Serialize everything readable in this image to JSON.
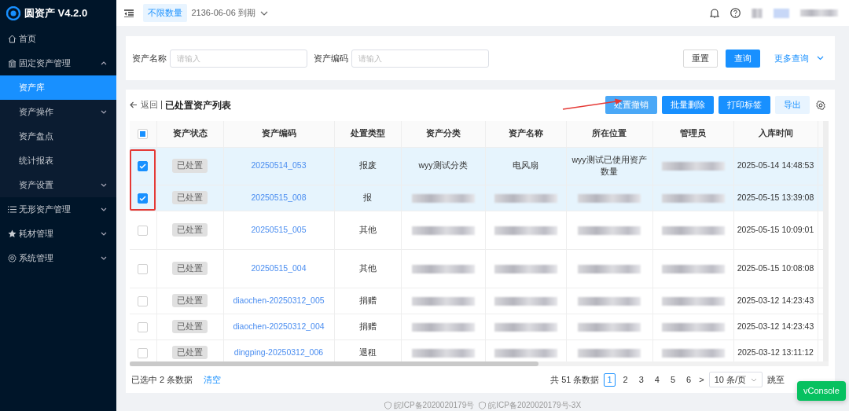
{
  "app": {
    "name": "圆资产 V4.2.0"
  },
  "sidebar": {
    "items": [
      {
        "label": "首页",
        "expandable": false,
        "selected": false
      },
      {
        "label": "固定资产管理",
        "expandable": true,
        "expanded": true,
        "selected": false,
        "children": [
          {
            "label": "资产库",
            "expandable": false,
            "selected": true
          },
          {
            "label": "资产操作",
            "expandable": true,
            "selected": false
          },
          {
            "label": "资产盘点",
            "expandable": false,
            "selected": false
          },
          {
            "label": "统计报表",
            "expandable": false,
            "selected": false
          },
          {
            "label": "资产设置",
            "expandable": true,
            "selected": false
          }
        ]
      },
      {
        "label": "无形资产管理",
        "expandable": true,
        "expanded": false,
        "selected": false
      },
      {
        "label": "耗材管理",
        "expandable": true,
        "expanded": false,
        "selected": false
      },
      {
        "label": "系统管理",
        "expandable": true,
        "expanded": false,
        "selected": false
      }
    ]
  },
  "header": {
    "license_tag": "不限数量",
    "expiry": "2136-06-06 到期"
  },
  "search": {
    "fields": [
      {
        "label": "资产名称",
        "placeholder": "请输入"
      },
      {
        "label": "资产编码",
        "placeholder": "请输入"
      }
    ],
    "buttons": [
      {
        "label": "重置",
        "kind": "outline"
      },
      {
        "label": "查询",
        "kind": "primary"
      }
    ],
    "more": "更多查询"
  },
  "list": {
    "back": "返回",
    "title": "已处置资产列表",
    "actions": [
      {
        "label": "处置撤销",
        "kind": "soft"
      },
      {
        "label": "批量删除",
        "kind": "primary"
      },
      {
        "label": "打印标签",
        "kind": "primary"
      },
      {
        "label": "导出",
        "kind": "light"
      }
    ],
    "header_checkbox": {
      "checked": false,
      "indeterminate": true
    },
    "columns": [
      "资产状态",
      "资产编码",
      "处置类型",
      "资产分类",
      "资产名称",
      "所在位置",
      "管理员",
      "入库时间"
    ],
    "rows": [
      {
        "checked": true,
        "cells": [
          "已处置",
          "20250514_053",
          "报废",
          "wyy测试分类",
          "电风扇",
          "wyy测试已使用资产数量",
          null,
          "2025-05-14 14:48:53"
        ]
      },
      {
        "checked": true,
        "cells": [
          "已处置",
          "20250515_008",
          "报",
          null,
          null,
          null,
          null,
          "2025-05-15 13:39:08"
        ]
      },
      {
        "checked": false,
        "cells": [
          "已处置",
          "20250515_005",
          "其他",
          null,
          null,
          null,
          null,
          "2025-05-15 10:09:01"
        ]
      },
      {
        "checked": false,
        "cells": [
          "已处置",
          "20250515_004",
          "其他",
          null,
          null,
          null,
          null,
          "2025-05-15 10:08:08"
        ]
      },
      {
        "checked": false,
        "cells": [
          "已处置",
          "diaochen-20250312_005",
          "捐赠",
          null,
          null,
          null,
          null,
          "2025-03-12 14:23:43"
        ]
      },
      {
        "checked": false,
        "cells": [
          "已处置",
          "diaochen-20250312_004",
          "捐赠",
          null,
          null,
          null,
          null,
          "2025-03-12 14:23:43"
        ]
      },
      {
        "checked": false,
        "cells": [
          "已处置",
          "dingping-20250312_006",
          "退租",
          null,
          null,
          null,
          null,
          "2025-03-12 13:11:12"
        ]
      }
    ],
    "selected_info": "已选中 2 条数据",
    "clear": "清空",
    "total": "共 51 条数据",
    "pages": [
      {
        "label": "1",
        "selected": true
      },
      {
        "label": "2",
        "selected": false
      },
      {
        "label": "3",
        "selected": false
      },
      {
        "label": "4",
        "selected": false
      },
      {
        "label": "5",
        "selected": false
      },
      {
        "label": "6",
        "selected": false
      }
    ],
    "next": ">",
    "page_size": "10 条/页",
    "jump": "跳至"
  },
  "footer": [
    "皖ICP备2020020179号",
    "皖ICP备2020020179号-3X"
  ],
  "vconsole": "vConsole"
}
